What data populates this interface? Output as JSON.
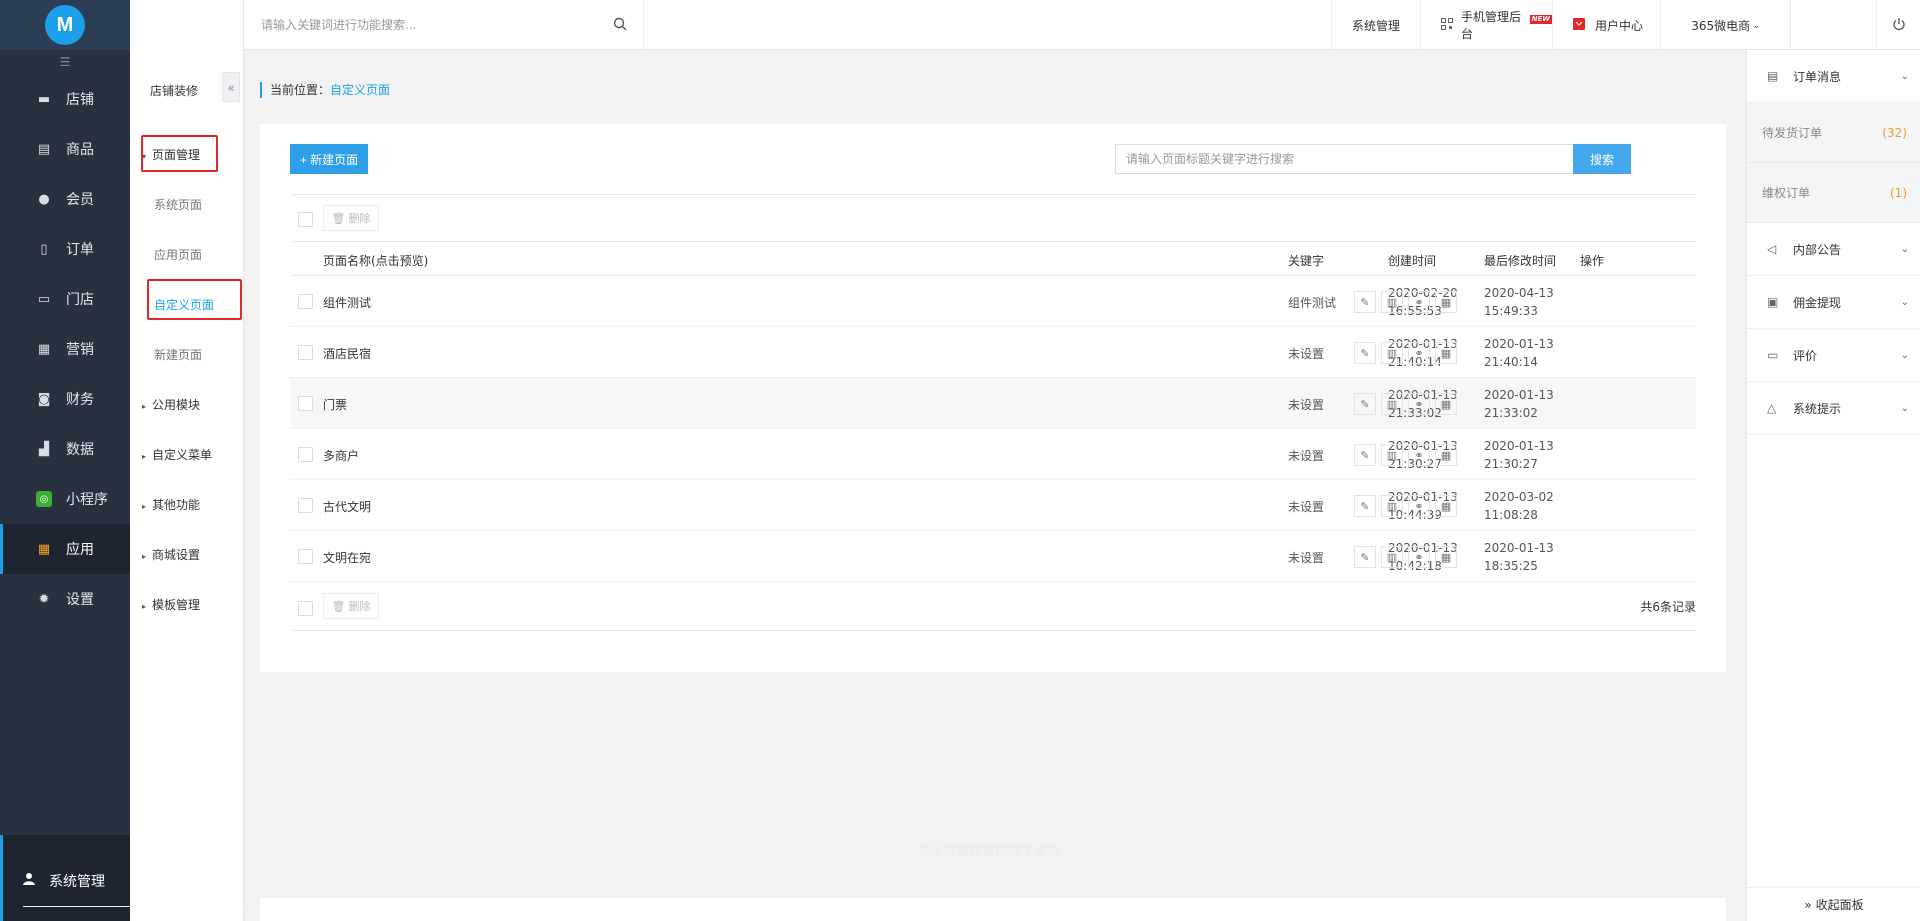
{
  "sidebar": {
    "logo_text": "M",
    "items": [
      {
        "label": "店铺",
        "icon": "store-icon",
        "glyph": "▬"
      },
      {
        "label": "商品",
        "icon": "goods-icon",
        "glyph": "▤"
      },
      {
        "label": "会员",
        "icon": "member-icon",
        "glyph": "●"
      },
      {
        "label": "订单",
        "icon": "order-icon",
        "glyph": "▯"
      },
      {
        "label": "门店",
        "icon": "shop-icon",
        "glyph": "▭"
      },
      {
        "label": "营销",
        "icon": "marketing-icon",
        "glyph": "▦"
      },
      {
        "label": "财务",
        "icon": "finance-icon",
        "glyph": "◙"
      },
      {
        "label": "数据",
        "icon": "data-icon",
        "glyph": "▟"
      },
      {
        "label": "小程序",
        "icon": "miniprogram-icon",
        "glyph": "◎"
      },
      {
        "label": "应用",
        "icon": "apps-icon",
        "glyph": "▦",
        "active": true
      },
      {
        "label": "设置",
        "icon": "settings-icon",
        "glyph": "✹"
      }
    ],
    "bottom_label": "系统管理"
  },
  "subnav": {
    "title": "店铺装修",
    "collapse_glyph": "«",
    "groups": {
      "page_mgmt": "页面管理",
      "system_page": "系统页面",
      "app_page": "应用页面",
      "custom_page": "自定义页面",
      "new_page": "新建页面",
      "public_module": "公用模块",
      "custom_menu": "自定义菜单",
      "other_func": "其他功能",
      "mall_settings": "商城设置",
      "template_mgmt": "模板管理"
    }
  },
  "topbar": {
    "search_placeholder": "请输入关键词进行功能搜索...",
    "system_mgmt": "系统管理",
    "mobile_backend": "手机管理后台",
    "new_badge": "NEW",
    "user_center": "用户中心",
    "shop_name": "365微电商"
  },
  "breadcrumb": {
    "prefix": "当前位置：",
    "current": "自定义页面"
  },
  "main": {
    "new_button": "+ 新建页面",
    "search_placeholder": "请输入页面标题关键字进行搜索",
    "search_button": "搜索",
    "delete_label": "删除",
    "columns": {
      "name": "页面名称(点击预览)",
      "keyword": "关键字",
      "created": "创建时间",
      "modified": "最后修改时间",
      "actions": "操作"
    },
    "rows": [
      {
        "name": "组件测试",
        "keyword": "组件测试",
        "created_date": "2020-02-20",
        "created_time": "16:55:53",
        "modified_date": "2020-04-13",
        "modified_time": "15:49:33"
      },
      {
        "name": "酒店民宿",
        "keyword": "未设置",
        "created_date": "2020-01-13",
        "created_time": "21:40:14",
        "modified_date": "2020-01-13",
        "modified_time": "21:40:14"
      },
      {
        "name": "门票",
        "keyword": "未设置",
        "created_date": "2020-01-13",
        "created_time": "21:33:02",
        "modified_date": "2020-01-13",
        "modified_time": "21:33:02"
      },
      {
        "name": "多商户",
        "keyword": "未设置",
        "created_date": "2020-01-13",
        "created_time": "21:30:27",
        "modified_date": "2020-01-13",
        "modified_time": "21:30:27"
      },
      {
        "name": "古代文明",
        "keyword": "未设置",
        "created_date": "2020-01-13",
        "created_time": "10:44:39",
        "modified_date": "2020-03-02",
        "modified_time": "11:08:28"
      },
      {
        "name": "文明在宛",
        "keyword": "未设置",
        "created_date": "2020-01-13",
        "created_time": "10:42:18",
        "modified_date": "2020-01-13",
        "modified_time": "18:35:25"
      }
    ],
    "total_text": "共6条记录",
    "footer_text": "米多微商城提供技术支持"
  },
  "right_panel": {
    "order_messages": "订单消息",
    "pending_ship": "待发货订单",
    "pending_ship_count": "(32)",
    "rights_orders": "维权订单",
    "rights_count": "(1)",
    "internal_notice": "内部公告",
    "commission": "佣金提现",
    "review": "评价",
    "system_tips": "系统提示",
    "collapse_panel": "» 收起面板"
  }
}
